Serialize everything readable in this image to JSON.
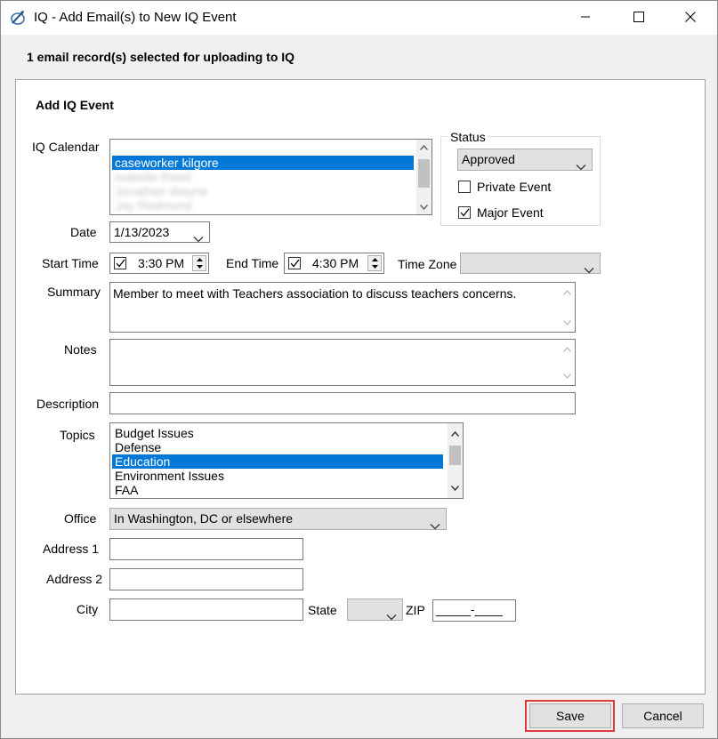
{
  "window": {
    "title": "IQ - Add Email(s) to New IQ Event",
    "controls": [
      "minimize-icon",
      "maximize-icon",
      "close-icon"
    ]
  },
  "subheader": "1 email record(s) selected for uploading to IQ",
  "form": {
    "section_title": "Add IQ Event",
    "calendar": {
      "label": "IQ Calendar",
      "items": [
        "",
        "caseworker kilgore",
        "Isabelle Reed",
        "Jonathan Wayne",
        "Jay Redmond"
      ],
      "selected_index": 1
    },
    "status": {
      "group_label": "Status",
      "value": "Approved",
      "private_event": {
        "label": "Private Event",
        "checked": false
      },
      "major_event": {
        "label": "Major Event",
        "checked": true
      }
    },
    "date": {
      "label": "Date",
      "value": "1/13/2023"
    },
    "start_time": {
      "label": "Start Time",
      "value": "3:30 PM",
      "checked": true
    },
    "end_time": {
      "label": "End Time",
      "value": "4:30 PM",
      "checked": true
    },
    "time_zone": {
      "label": "Time Zone",
      "value": ""
    },
    "summary": {
      "label": "Summary",
      "value": "Member to meet with Teachers association to discuss teachers concerns."
    },
    "notes": {
      "label": "Notes",
      "value": ""
    },
    "description": {
      "label": "Description",
      "value": ""
    },
    "topics": {
      "label": "Topics",
      "items": [
        "Budget Issues",
        "Defense",
        "Education",
        "Environment Issues",
        "FAA"
      ],
      "selected_index": 2
    },
    "office": {
      "label": "Office",
      "value": "In Washington, DC or elsewhere"
    },
    "address1": {
      "label": "Address 1",
      "value": ""
    },
    "address2": {
      "label": "Address 2",
      "value": ""
    },
    "city": {
      "label": "City",
      "value": ""
    },
    "state": {
      "label": "State",
      "value": ""
    },
    "zip": {
      "label": "ZIP",
      "value": "_____-____"
    }
  },
  "buttons": {
    "save": "Save",
    "cancel": "Cancel"
  },
  "colors": {
    "selection": "#0078d7",
    "highlight_border": "#e0393e",
    "window_bg": "#f0f0f0"
  }
}
